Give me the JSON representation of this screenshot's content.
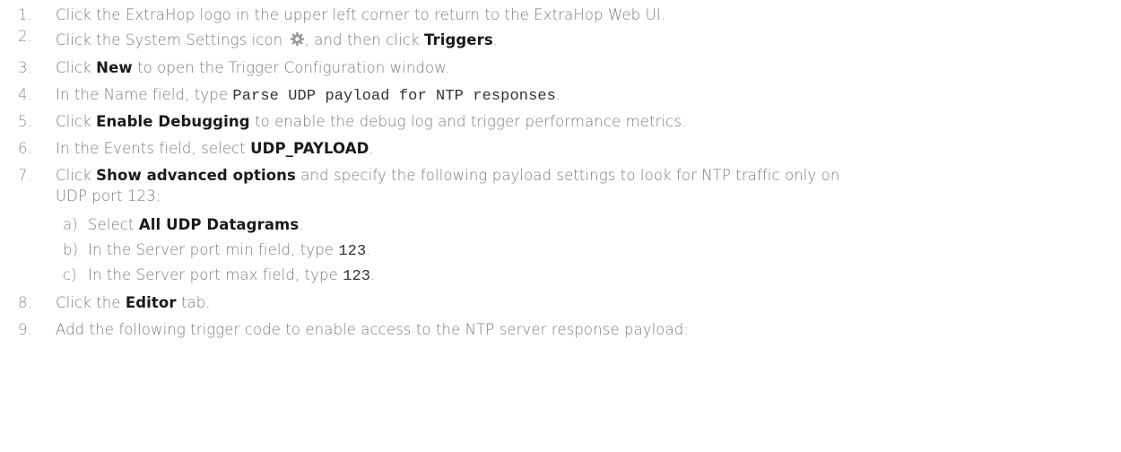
{
  "steps": [
    {
      "number": "1.",
      "text": "Click the ExtraHop logo in the upper left corner to return to the ExtraHop Web UI."
    },
    {
      "number": "2.",
      "text_before": "Click the System Settings icon",
      "icon": "gear-icon",
      "text_middle": ", and then click ",
      "bold": "Triggers",
      "text_after": "."
    },
    {
      "number": "3.",
      "text_before": "Click ",
      "bold": "New",
      "text_after": " to open the Trigger Configuration window."
    },
    {
      "number": "4.",
      "text_before": "In the Name field, type ",
      "code": "Parse UDP payload for NTP responses",
      "text_after": "."
    },
    {
      "number": "5.",
      "text_before": "Click ",
      "bold": "Enable Debugging",
      "text_after": " to enable the debug log and trigger performance metrics."
    },
    {
      "number": "6.",
      "text_before": "In the Events field, select ",
      "bold": "UDP_PAYLOAD",
      "text_after": "."
    },
    {
      "number": "7.",
      "text_before": "Click ",
      "bold": "Show advanced options",
      "text_after_line1": " and specify the following payload settings to look for NTP traffic only on",
      "text_after_line2": "UDP port 123:",
      "substeps": [
        {
          "letter": "a)",
          "text_before": "Select ",
          "bold": "All UDP Datagrams",
          "text_after": "."
        },
        {
          "letter": "b)",
          "text_before": "In the Server port min field, type ",
          "code": "123",
          "text_after": "."
        },
        {
          "letter": "c)",
          "text_before": "In the Server port max field, type ",
          "code": "123",
          "text_after": "."
        }
      ]
    },
    {
      "number": "8.",
      "text_before": "Click the ",
      "bold": "Editor",
      "text_after": " tab."
    },
    {
      "number": "9.",
      "text": "Add the following trigger code to enable access to the NTP server response payload:"
    }
  ],
  "colors": {
    "body_text": "#7a7a7a",
    "bold_text": "#1a1a1a",
    "code_text": "#333333",
    "icon": "#9a9a9a"
  }
}
